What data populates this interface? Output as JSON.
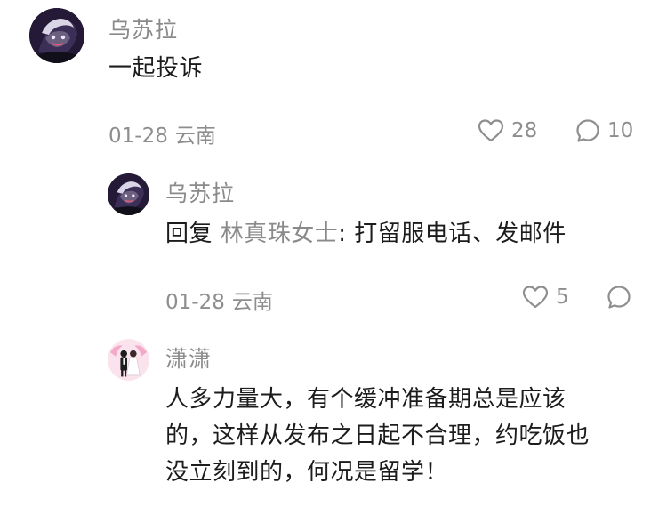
{
  "comments": [
    {
      "username": "乌苏拉",
      "content": "一起投诉",
      "date": "01-28",
      "location": "云南",
      "likes": "28",
      "replies": "10"
    },
    {
      "username": "乌苏拉",
      "reply_prefix": "回复 ",
      "reply_target": "林真珠女士",
      "content": ": 打留服电话、发邮件",
      "date": "01-28",
      "location": "云南",
      "likes": "5"
    },
    {
      "username": "潇潇",
      "content_lines": [
        "人多力量大，有个缓冲准备期总是应该",
        "的，这样从发布之日起不合理，约吃饭也",
        "没立刻到的，何况是留学！"
      ]
    }
  ],
  "icons": {
    "like": "heart-outline-icon",
    "reply": "speech-bubble-outline-icon"
  },
  "colors": {
    "text": "#1c1c1c",
    "muted": "#8a8a8a",
    "background": "#ffffff"
  }
}
